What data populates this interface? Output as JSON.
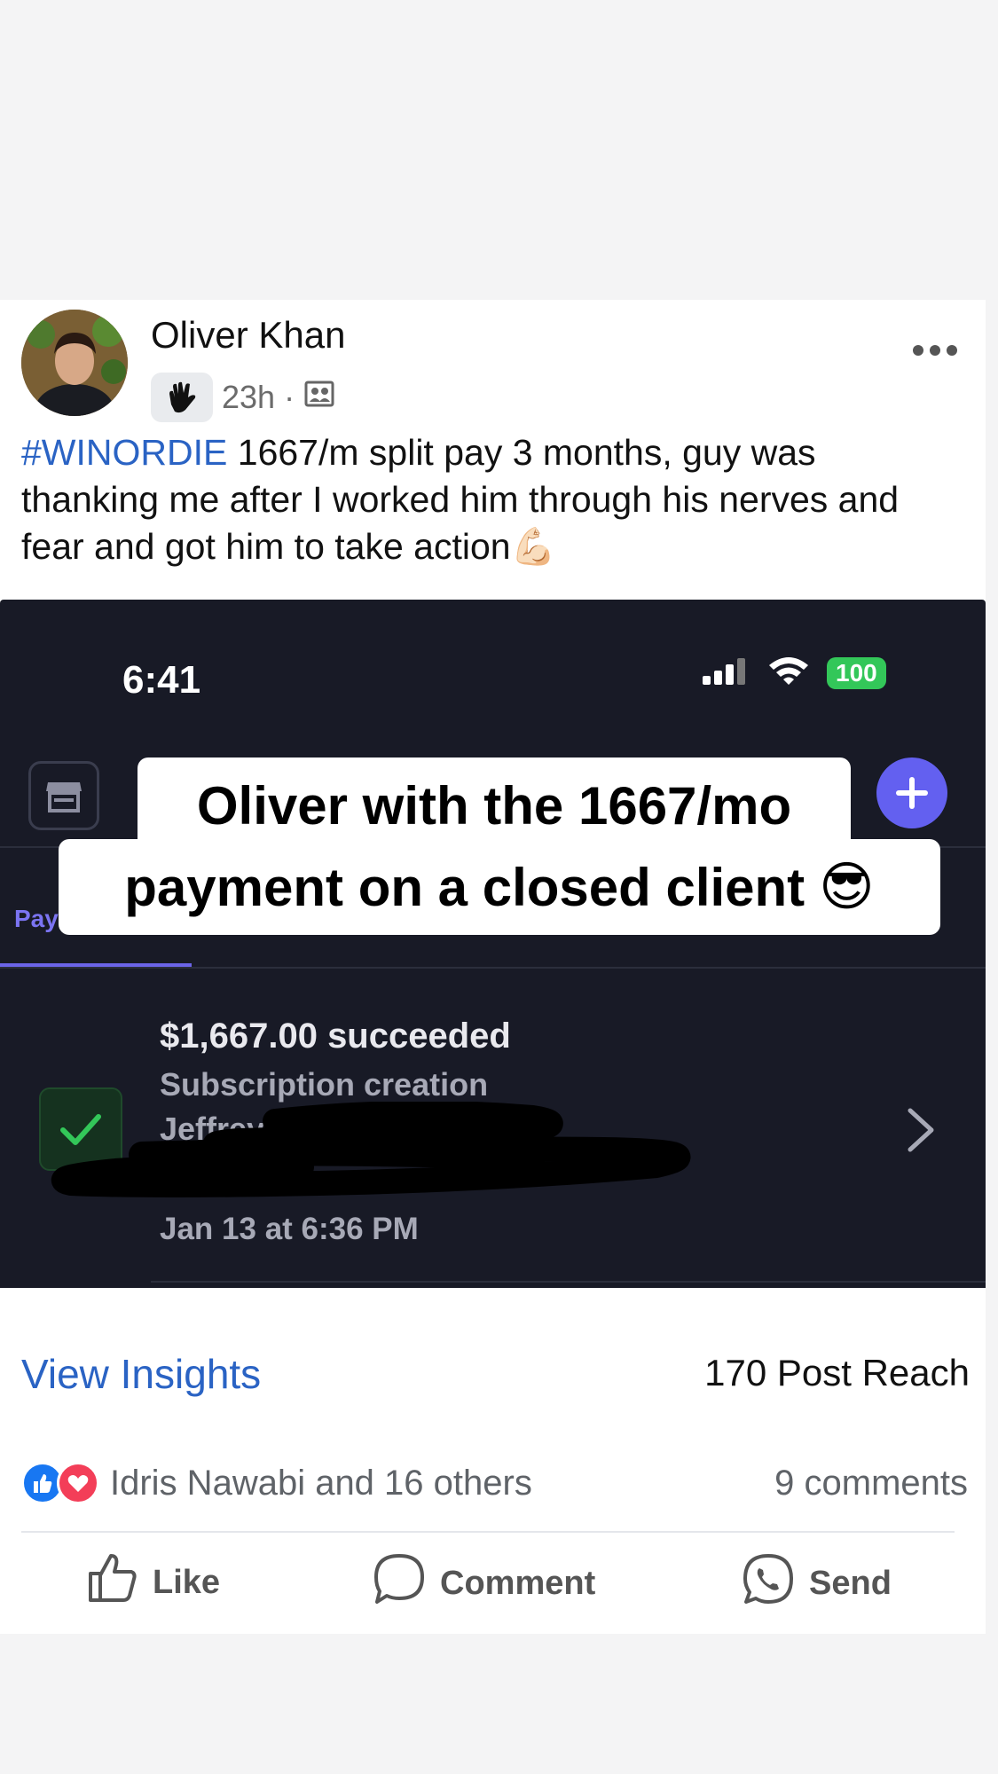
{
  "post": {
    "author": "Oliver Khan",
    "time": "23h",
    "separator": "·",
    "hashtag": "#WINORDIE",
    "caption": "1667/m split pay 3 months, guy was thanking me after I worked him through his nerves and fear and got him to take action",
    "caption_emoji": "💪🏻"
  },
  "screenshot": {
    "status_time": "6:41",
    "battery": "100",
    "overlay_line1": "Oliver with the 1667/mo",
    "overlay_line2": "payment on a closed client",
    "overlay_emoji": "😎",
    "tab_active": "Pay",
    "payment": {
      "amount": "$1,667.00 succeeded",
      "description": "Subscription creation",
      "customer": "Jeffrey",
      "date": "Jan 13 at 6:36 PM"
    }
  },
  "footer": {
    "view_insights": "View Insights",
    "post_reach": "170 Post Reach",
    "reactors": "Idris Nawabi and 16 others",
    "comments": "9 comments",
    "like": "Like",
    "comment": "Comment",
    "send": "Send"
  },
  "colors": {
    "link_blue": "#2a63c4",
    "dark_bg": "#181a26",
    "accent_purple": "#6360f0",
    "success_green": "#33c759"
  }
}
